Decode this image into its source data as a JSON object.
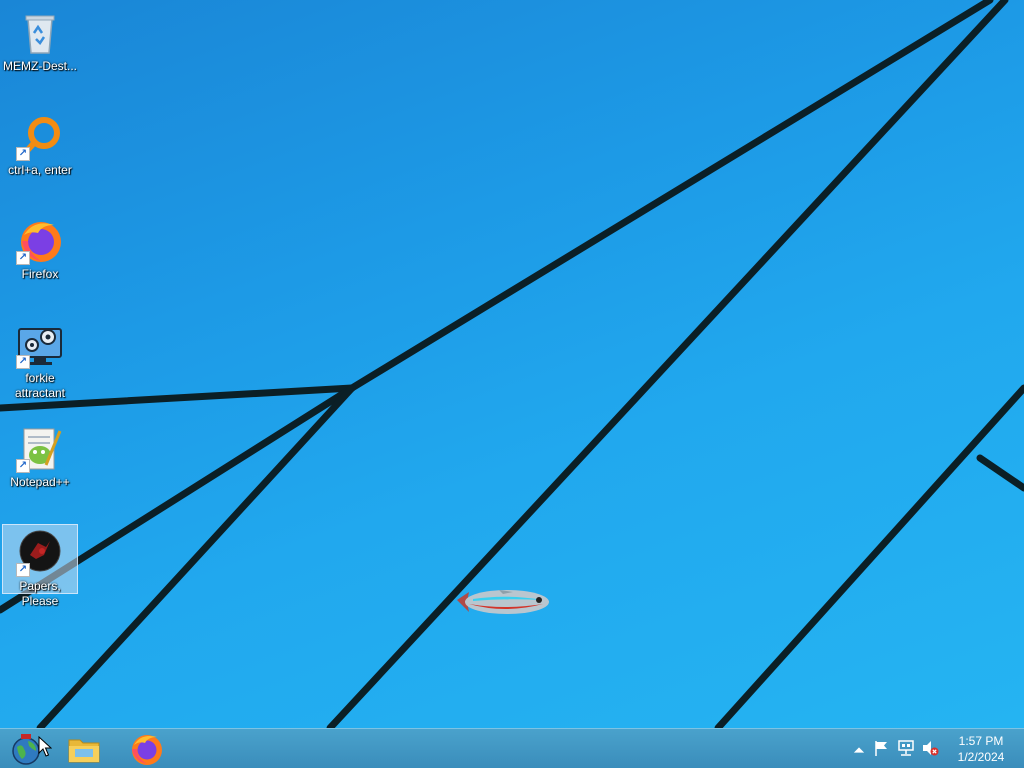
{
  "desktop": {
    "icons": [
      {
        "label": "MEMZ-Dest...",
        "icon": "recycle-bin-icon"
      },
      {
        "label": "ctrl+a, enter",
        "icon": "orange-ring-icon"
      },
      {
        "label": "Firefox",
        "icon": "firefox-icon"
      },
      {
        "label": "forkie attractant",
        "icon": "monitor-gears-icon"
      },
      {
        "label": "Notepad++",
        "icon": "notepad-plus-plus-icon"
      },
      {
        "label": "Papers, Please",
        "icon": "papers-please-icon"
      }
    ],
    "selected_icon": "Papers, Please",
    "wallpaper": "windows-8-style blue with dark diagonal lines",
    "fish": "neon-tetra-fish"
  },
  "taskbar": {
    "items": [
      {
        "name": "start-button",
        "icon": "globe-start-icon"
      },
      {
        "name": "file-explorer",
        "icon": "folder-icon"
      },
      {
        "name": "firefox",
        "icon": "firefox-icon"
      }
    ],
    "tray": {
      "icons": [
        "show-hidden-icons-arrow",
        "action-center-flag-icon",
        "network-icon",
        "volume-muted-icon"
      ],
      "time": "1:57 PM",
      "date": "1/2/2024"
    }
  },
  "colors": {
    "desktop_blue": "#1e9ee6",
    "taskbar": "#3f93c2",
    "lines": "#0b1f26"
  }
}
